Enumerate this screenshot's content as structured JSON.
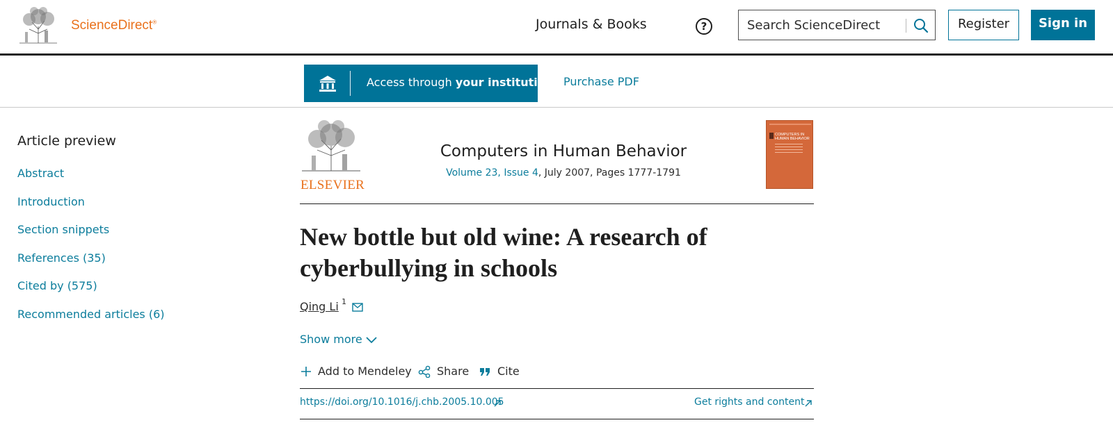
{
  "header": {
    "brand": "ScienceDirect",
    "brand_tm": "®",
    "nav_journals": "Journals & Books",
    "help_symbol": "?",
    "search_placeholder": "Search ScienceDirect",
    "register": "Register",
    "sign_in": "Sign in"
  },
  "access_bar": {
    "access_prefix": "Access through ",
    "access_bold": "your institution",
    "purchase_pdf": "Purchase PDF"
  },
  "sidebar": {
    "title": "Article preview",
    "items": [
      {
        "label": "Abstract"
      },
      {
        "label": "Introduction"
      },
      {
        "label": "Section snippets"
      },
      {
        "label": "References (35)"
      },
      {
        "label": "Cited by (575)"
      },
      {
        "label": "Recommended articles (6)"
      }
    ]
  },
  "journal": {
    "publisher_wordmark": "ELSEVIER",
    "name": "Computers in Human Behavior",
    "volume_link": "Volume 23, Issue 4",
    "volume_rest": ", July 2007, Pages 1777-1791",
    "cover_title_line1": "COMPUTERS IN",
    "cover_title_line2": "HUMAN BEHAVIOR"
  },
  "article": {
    "title": "New bottle but old wine: A research of cyberbullying in schools",
    "author": "Qing Li",
    "author_sup": "1",
    "show_more": "Show more",
    "actions": {
      "mendeley": "Add to Mendeley",
      "share": "Share",
      "cite": "Cite"
    },
    "doi": "https://doi.org/10.1016/j.chb.2005.10.005",
    "rights": "Get rights and content"
  },
  "colors": {
    "accent": "#007398",
    "link": "#0c7d9c",
    "brand_orange": "#e9711c",
    "cover": "#d4683a"
  }
}
